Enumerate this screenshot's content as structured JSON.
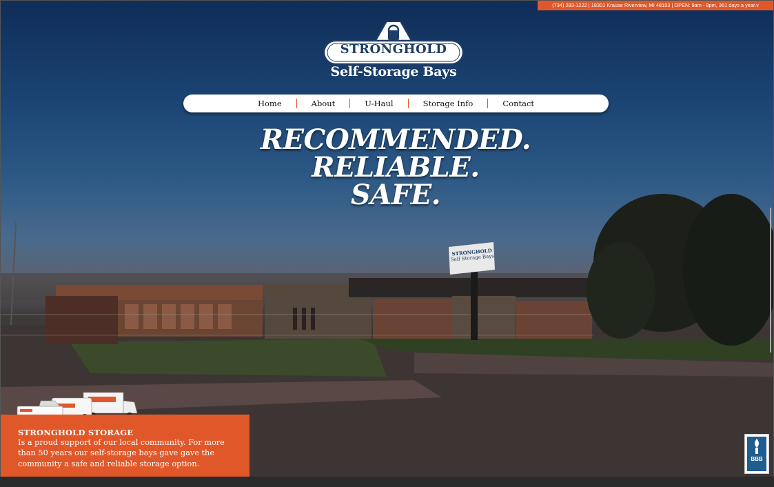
{
  "topbar": {
    "info": "(734) 283-1222 | 18301 Krause Riverview, MI 48193 | OPEN: 9am - 8pm, 361 days a year.v"
  },
  "logo": {
    "name": "STRONGHOLD",
    "subtitle": "Self-Storage Bays",
    "icon": "padlock-icon"
  },
  "nav": {
    "items": [
      {
        "label": "Home"
      },
      {
        "label": "About"
      },
      {
        "label": "U-Haul"
      },
      {
        "label": "Storage Info"
      },
      {
        "label": "Contact"
      }
    ]
  },
  "hero": {
    "line1": "RECOMMENDED.",
    "line2": "RELIABLE.",
    "line3": "SAFE."
  },
  "sign": {
    "name": "STRONGHOLD",
    "subtitle": "Self Storage Bays"
  },
  "infobox": {
    "title": "STRONGHOLD STORAGE",
    "text": "Is a proud support of our local community. For more than 50 years our self-storage bays gave gave the community a safe and reliable storage option."
  },
  "badge": {
    "icon": "bbb-badge-icon",
    "label": "BBB"
  },
  "colors": {
    "accent": "#e0582a",
    "nav_bg": "#ffffff",
    "logo_blue": "#1f3d66"
  }
}
